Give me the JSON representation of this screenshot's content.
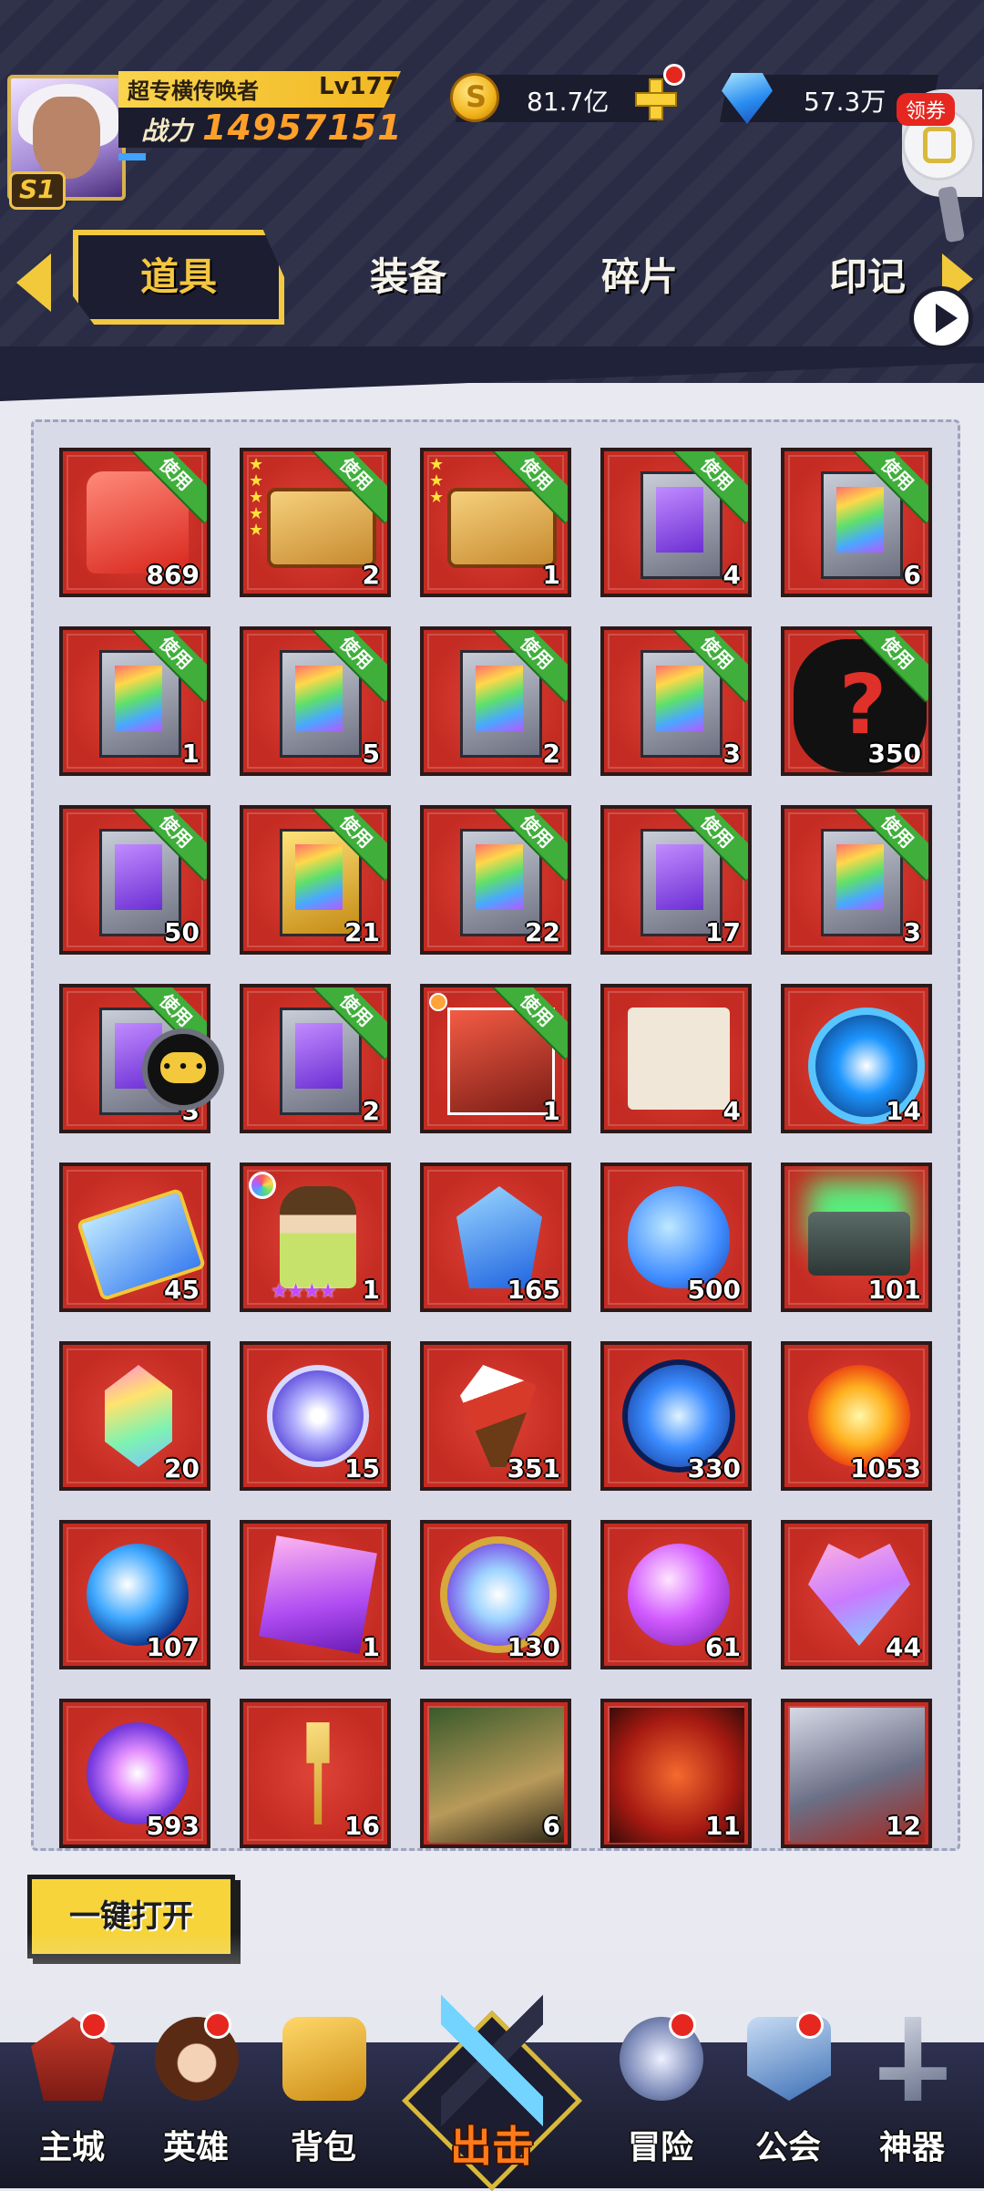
{
  "player": {
    "name": "超专横传唤者",
    "level": "Lv177",
    "season": "S1",
    "power_label": "战力",
    "power": "14957151"
  },
  "currency": {
    "gold": "81.7亿",
    "gems": "57.3万",
    "coupon_label": "领券"
  },
  "tabs": [
    "道具",
    "装备",
    "碎片",
    "印记"
  ],
  "use_tag": "使用",
  "items": [
    {
      "icon": "red-gift-bag-icon",
      "qty": "869",
      "use": true
    },
    {
      "icon": "five-star-treasure-chest-icon",
      "qty": "2",
      "use": true
    },
    {
      "icon": "three-star-treasure-chest-icon",
      "qty": "1",
      "use": true
    },
    {
      "icon": "purple-card-pack-icon",
      "qty": "4",
      "use": true
    },
    {
      "icon": "rainbow-card-pack-icon",
      "qty": "6",
      "use": true
    },
    {
      "icon": "rainbow-card-pack-icon",
      "qty": "1",
      "use": true
    },
    {
      "icon": "rainbow-card-pack-icon",
      "qty": "5",
      "use": true
    },
    {
      "icon": "rainbow-card-pack-icon",
      "qty": "2",
      "use": true
    },
    {
      "icon": "rainbow-card-pack-icon",
      "qty": "3",
      "use": true
    },
    {
      "icon": "mystery-silhouette-icon",
      "qty": "350",
      "use": true
    },
    {
      "icon": "purple-card-pack-icon",
      "qty": "50",
      "use": true
    },
    {
      "icon": "gold-17plus-card-pack-icon",
      "qty": "21",
      "use": true
    },
    {
      "icon": "glowing-card-pack-icon",
      "qty": "22",
      "use": true
    },
    {
      "icon": "purple-card-pack-icon",
      "qty": "17",
      "use": true
    },
    {
      "icon": "glowing-card-pack-icon",
      "qty": "3",
      "use": true
    },
    {
      "icon": "purple-card-pack-icon",
      "qty": "3",
      "use": true
    },
    {
      "icon": "purple-card-pack-icon",
      "qty": "2",
      "use": true
    },
    {
      "icon": "card-box-set-icon",
      "qty": "1",
      "use": true
    },
    {
      "icon": "scroll-document-icon",
      "qty": "4",
      "use": false
    },
    {
      "icon": "mechanical-ring-icon",
      "qty": "14",
      "use": false
    },
    {
      "icon": "star-ticket-icon",
      "qty": "45",
      "use": false
    },
    {
      "icon": "doll-figure-icon",
      "qty": "1",
      "use": false
    },
    {
      "icon": "blue-crystal-icon",
      "qty": "165",
      "use": false
    },
    {
      "icon": "blue-slime-drop-icon",
      "qty": "500",
      "use": false
    },
    {
      "icon": "green-glow-box-icon",
      "qty": "101",
      "use": false
    },
    {
      "icon": "rainbow-crystal-icon",
      "qty": "20",
      "use": false
    },
    {
      "icon": "star-coin-icon",
      "qty": "15",
      "use": false
    },
    {
      "icon": "flower-bouquet-icon",
      "qty": "351",
      "use": false
    },
    {
      "icon": "blue-gem-icon",
      "qty": "330",
      "use": false
    },
    {
      "icon": "fire-orb-icon",
      "qty": "1053",
      "use": false
    },
    {
      "icon": "blue-energy-orb-icon",
      "qty": "107",
      "use": false
    },
    {
      "icon": "pink-cube-icon",
      "qty": "1",
      "use": false
    },
    {
      "icon": "star-medal-icon",
      "qty": "130",
      "use": false
    },
    {
      "icon": "purple-sphere-icon",
      "qty": "61",
      "use": false
    },
    {
      "icon": "crystal-heart-icon",
      "qty": "44",
      "use": false
    },
    {
      "icon": "galaxy-swirl-icon",
      "qty": "593",
      "use": false
    },
    {
      "icon": "golden-key-icon",
      "qty": "16",
      "use": false
    },
    {
      "icon": "serpent-monster-icon",
      "qty": "6",
      "use": false
    },
    {
      "icon": "red-dragon-icon",
      "qty": "11",
      "use": false
    },
    {
      "icon": "white-beast-icon",
      "qty": "12",
      "use": false
    }
  ],
  "open_all_label": "一键打开",
  "nav": [
    {
      "label": "主城",
      "icon": "castle-icon",
      "badge": true
    },
    {
      "label": "英雄",
      "icon": "hero-portrait-icon",
      "badge": true
    },
    {
      "label": "背包",
      "icon": "backpack-icon",
      "badge": false
    },
    {
      "label": "出击",
      "icon": "crossed-swords-icon",
      "badge": false
    },
    {
      "label": "冒险",
      "icon": "compass-icon",
      "badge": true
    },
    {
      "label": "公会",
      "icon": "guild-banner-icon",
      "badge": true
    },
    {
      "label": "神器",
      "icon": "sword-artifact-icon",
      "badge": false
    }
  ],
  "colors": {
    "item_bg": "#d2362b",
    "use_tag": "#3fae3a",
    "tab_active": "#f2c940",
    "badge": "#e6271f"
  }
}
